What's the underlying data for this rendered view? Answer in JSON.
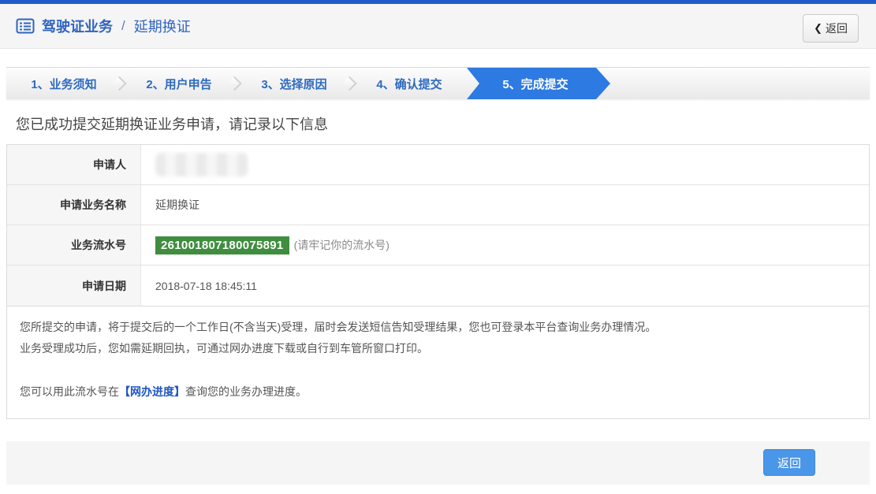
{
  "header": {
    "title_primary": "驾驶证业务",
    "title_separator": "/",
    "title_secondary": "延期换证",
    "back_chevron": "❮",
    "back_button_label": "返回"
  },
  "steps": [
    {
      "label": "1、业务须知",
      "active": false
    },
    {
      "label": "2、用户申告",
      "active": false
    },
    {
      "label": "3、选择原因",
      "active": false
    },
    {
      "label": "4、确认提交",
      "active": false
    },
    {
      "label": "5、完成提交",
      "active": true
    }
  ],
  "main": {
    "success_message": "您已成功提交延期换证业务申请，请记录以下信息",
    "info_rows": [
      {
        "label": "申请人",
        "value": "",
        "redacted": true
      },
      {
        "label": "申请业务名称",
        "value": "延期换证"
      },
      {
        "label": "业务流水号",
        "value": "261001807180075891",
        "note": "(请牢记你的流水号)"
      },
      {
        "label": "申请日期",
        "value": "2018-07-18 18:45:11"
      }
    ],
    "notes": [
      "您所提交的申请，将于提交后的一个工作日(不含当天)受理，届时会发送短信告知受理结果，您也可登录本平台查询业务办理情况。",
      "业务受理成功后，您如需延期回执，可通过网办进度下载或自行到车管所窗口打印。"
    ],
    "progress_line": {
      "prefix": "您可以用此流水号在",
      "link": "【网办进度】",
      "suffix": "查询您的业务办理进度。"
    }
  },
  "footer": {
    "back_button_label": "返回"
  },
  "colors": {
    "topbar_blue": "#1e5bc8",
    "accent_blue": "#2d7ae2",
    "title_blue": "#2f64c1",
    "serial_green": "#3f8e3f",
    "link_blue": "#1f56c4",
    "button_blue": "#4a96e8"
  }
}
